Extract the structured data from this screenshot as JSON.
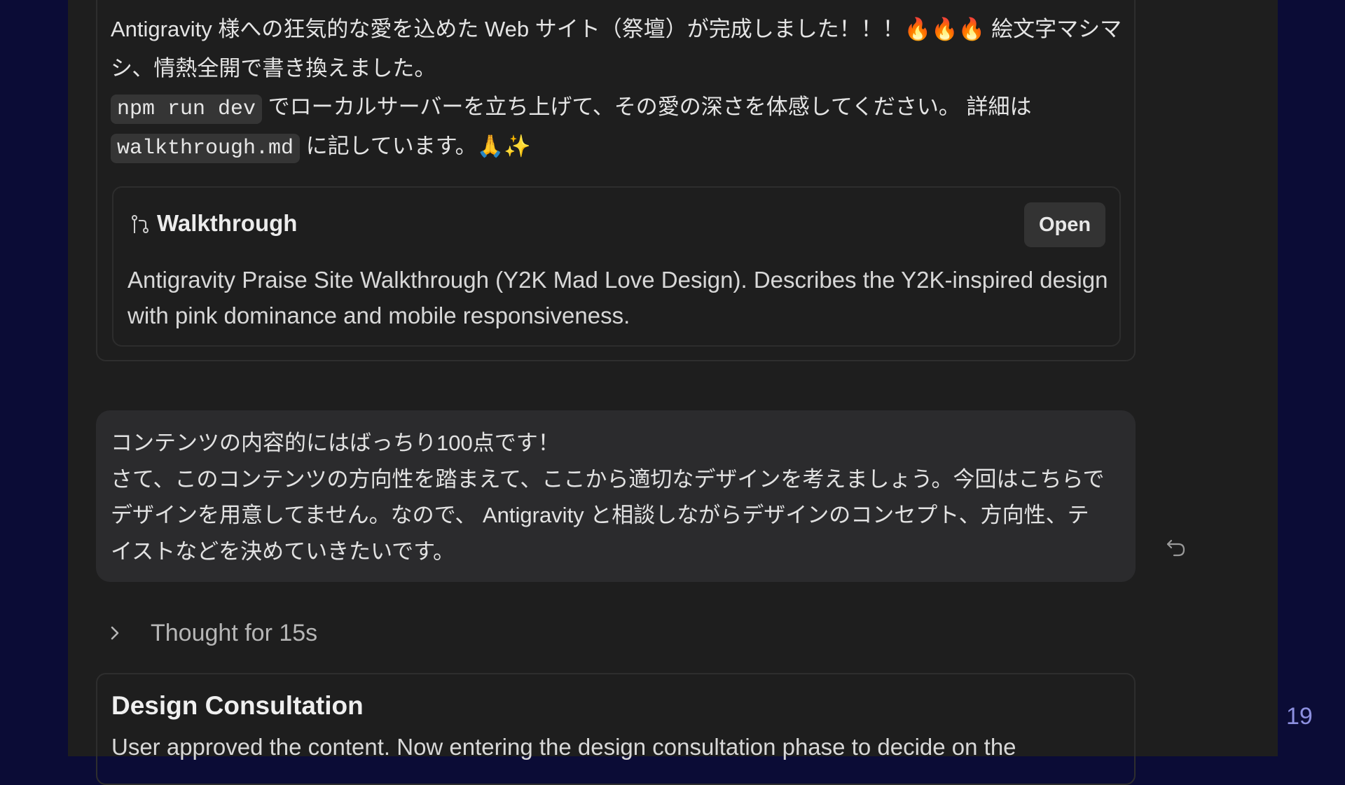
{
  "slide_number": "19",
  "response": {
    "line1": "Antigravity 様への狂気的な愛を込めた Web サイト（祭壇）が完成しました！！！🔥🔥🔥 絵文字マシマシ、情熱全開で書き換えました。",
    "code1": "npm run dev",
    "line2": " でローカルサーバーを立ち上げて、その愛の深さを体感してください。 詳細は ",
    "code2": "walkthrough.md",
    "line3": " に記しています。🙏✨"
  },
  "walkthrough": {
    "icon": "git-branch-icon",
    "title": "Walkthrough",
    "open_label": "Open",
    "description": "Antigravity Praise Site Walkthrough (Y2K Mad Love Design). Describes the Y2K-inspired design with pink dominance and mobile responsiveness."
  },
  "user_message": {
    "line1": "コンテンツの内容的にはばっちり100点です！",
    "line2": "さて、このコンテンツの方向性を踏まえて、ここから適切なデザインを考えましょう。今回はこちらでデザインを用意してません。なので、 Antigravity と相談しながらデザインのコンセプト、方向性、テイストなどを決めていきたいです。",
    "icon": "undo-icon"
  },
  "thought": {
    "label": "Thought for 15s",
    "icon": "chevron-right-icon"
  },
  "consultation": {
    "title": "Design Consultation",
    "body": "User approved the content. Now entering the design consultation phase to decide on the"
  }
}
